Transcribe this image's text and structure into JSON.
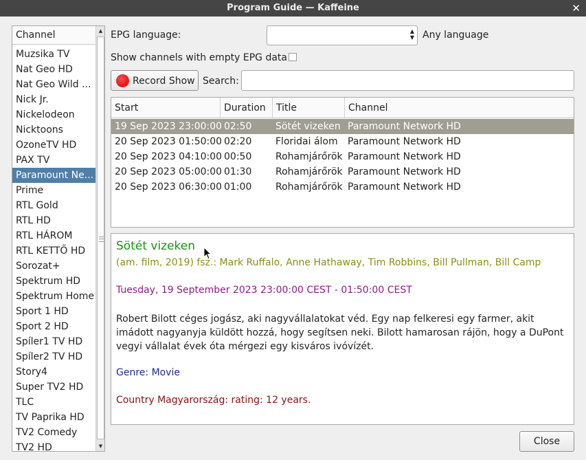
{
  "window": {
    "title": "Program Guide — Kaffeine",
    "close_glyph": "✕"
  },
  "channels": {
    "header": "Channel",
    "items": [
      "Muzsika TV",
      "Nat Geo HD",
      "Nat Geo Wild ...",
      "Nick Jr.",
      "Nickelodeon",
      "Nicktoons",
      "OzoneTV HD",
      "PAX TV",
      "Paramount Ne...",
      "Prime",
      "RTL Gold",
      "RTL HD",
      "RTL HÁROM",
      "RTL KETTŐ HD",
      "Sorozat+",
      "Spektrum HD",
      "Spektrum Home",
      "Sport 1 HD",
      "Sport 2 HD",
      "Spíler1 TV HD",
      "Spíler2 TV HD",
      "Story4",
      "Super TV2 HD",
      "TLC",
      "TV Paprika HD",
      "TV2 Comedy",
      "TV2 HD"
    ],
    "selected_index": 8
  },
  "controls": {
    "epg_language_label": "EPG language:",
    "epg_language_value": "",
    "any_language_label": "Any language",
    "show_empty_label": "Show channels with empty EPG data",
    "show_empty_checked": false,
    "record_label": "Record Show",
    "search_label": "Search:",
    "search_value": ""
  },
  "table": {
    "columns": [
      "Start",
      "Duration",
      "Title",
      "Channel"
    ],
    "rows": [
      [
        "19 Sep 2023 23:00:00",
        "02:50",
        "Sötét vizeken",
        "Paramount Network HD"
      ],
      [
        "20 Sep 2023 01:50:00",
        "02:20",
        "Floridai álom",
        "Paramount Network HD"
      ],
      [
        "20 Sep 2023 04:10:00",
        "00:50",
        "Rohamjárőrök",
        "Paramount Network HD"
      ],
      [
        "20 Sep 2023 05:00:00",
        "01:30",
        "Rohamjárőrök",
        "Paramount Network HD"
      ],
      [
        "20 Sep 2023 06:30:00",
        "01:00",
        "Rohamjárőrök",
        "Paramount Network HD"
      ]
    ],
    "selected_row": 0
  },
  "details": {
    "title": "Sötét vizeken",
    "subtitle": "(am. film, 2019) fsz.: Mark Ruffalo, Anne Hathaway, Tim Robbins, Bill Pullman, Bill Camp",
    "time": "Tuesday, 19 September 2023 23:00:00 CEST - 01:50:00 CEST",
    "description": "Robert Bilott céges jogász, aki nagyvállalatokat véd. Egy nap felkeresi egy farmer, akit imádott nagyanyja küldött hozzá, hogy segítsen neki. Bilott hamarosan rájön, hogy a DuPont vegyi vállalat évek óta mérgezi egy kisváros ivóvízét.",
    "genre": "Genre: Movie",
    "country": "Country Magyarország: rating: 12 years."
  },
  "footer": {
    "close_label": "Close"
  },
  "colors": {
    "selection": "#4f7fa8",
    "row_selection": "#a09e93",
    "title_green": "#16940d"
  }
}
